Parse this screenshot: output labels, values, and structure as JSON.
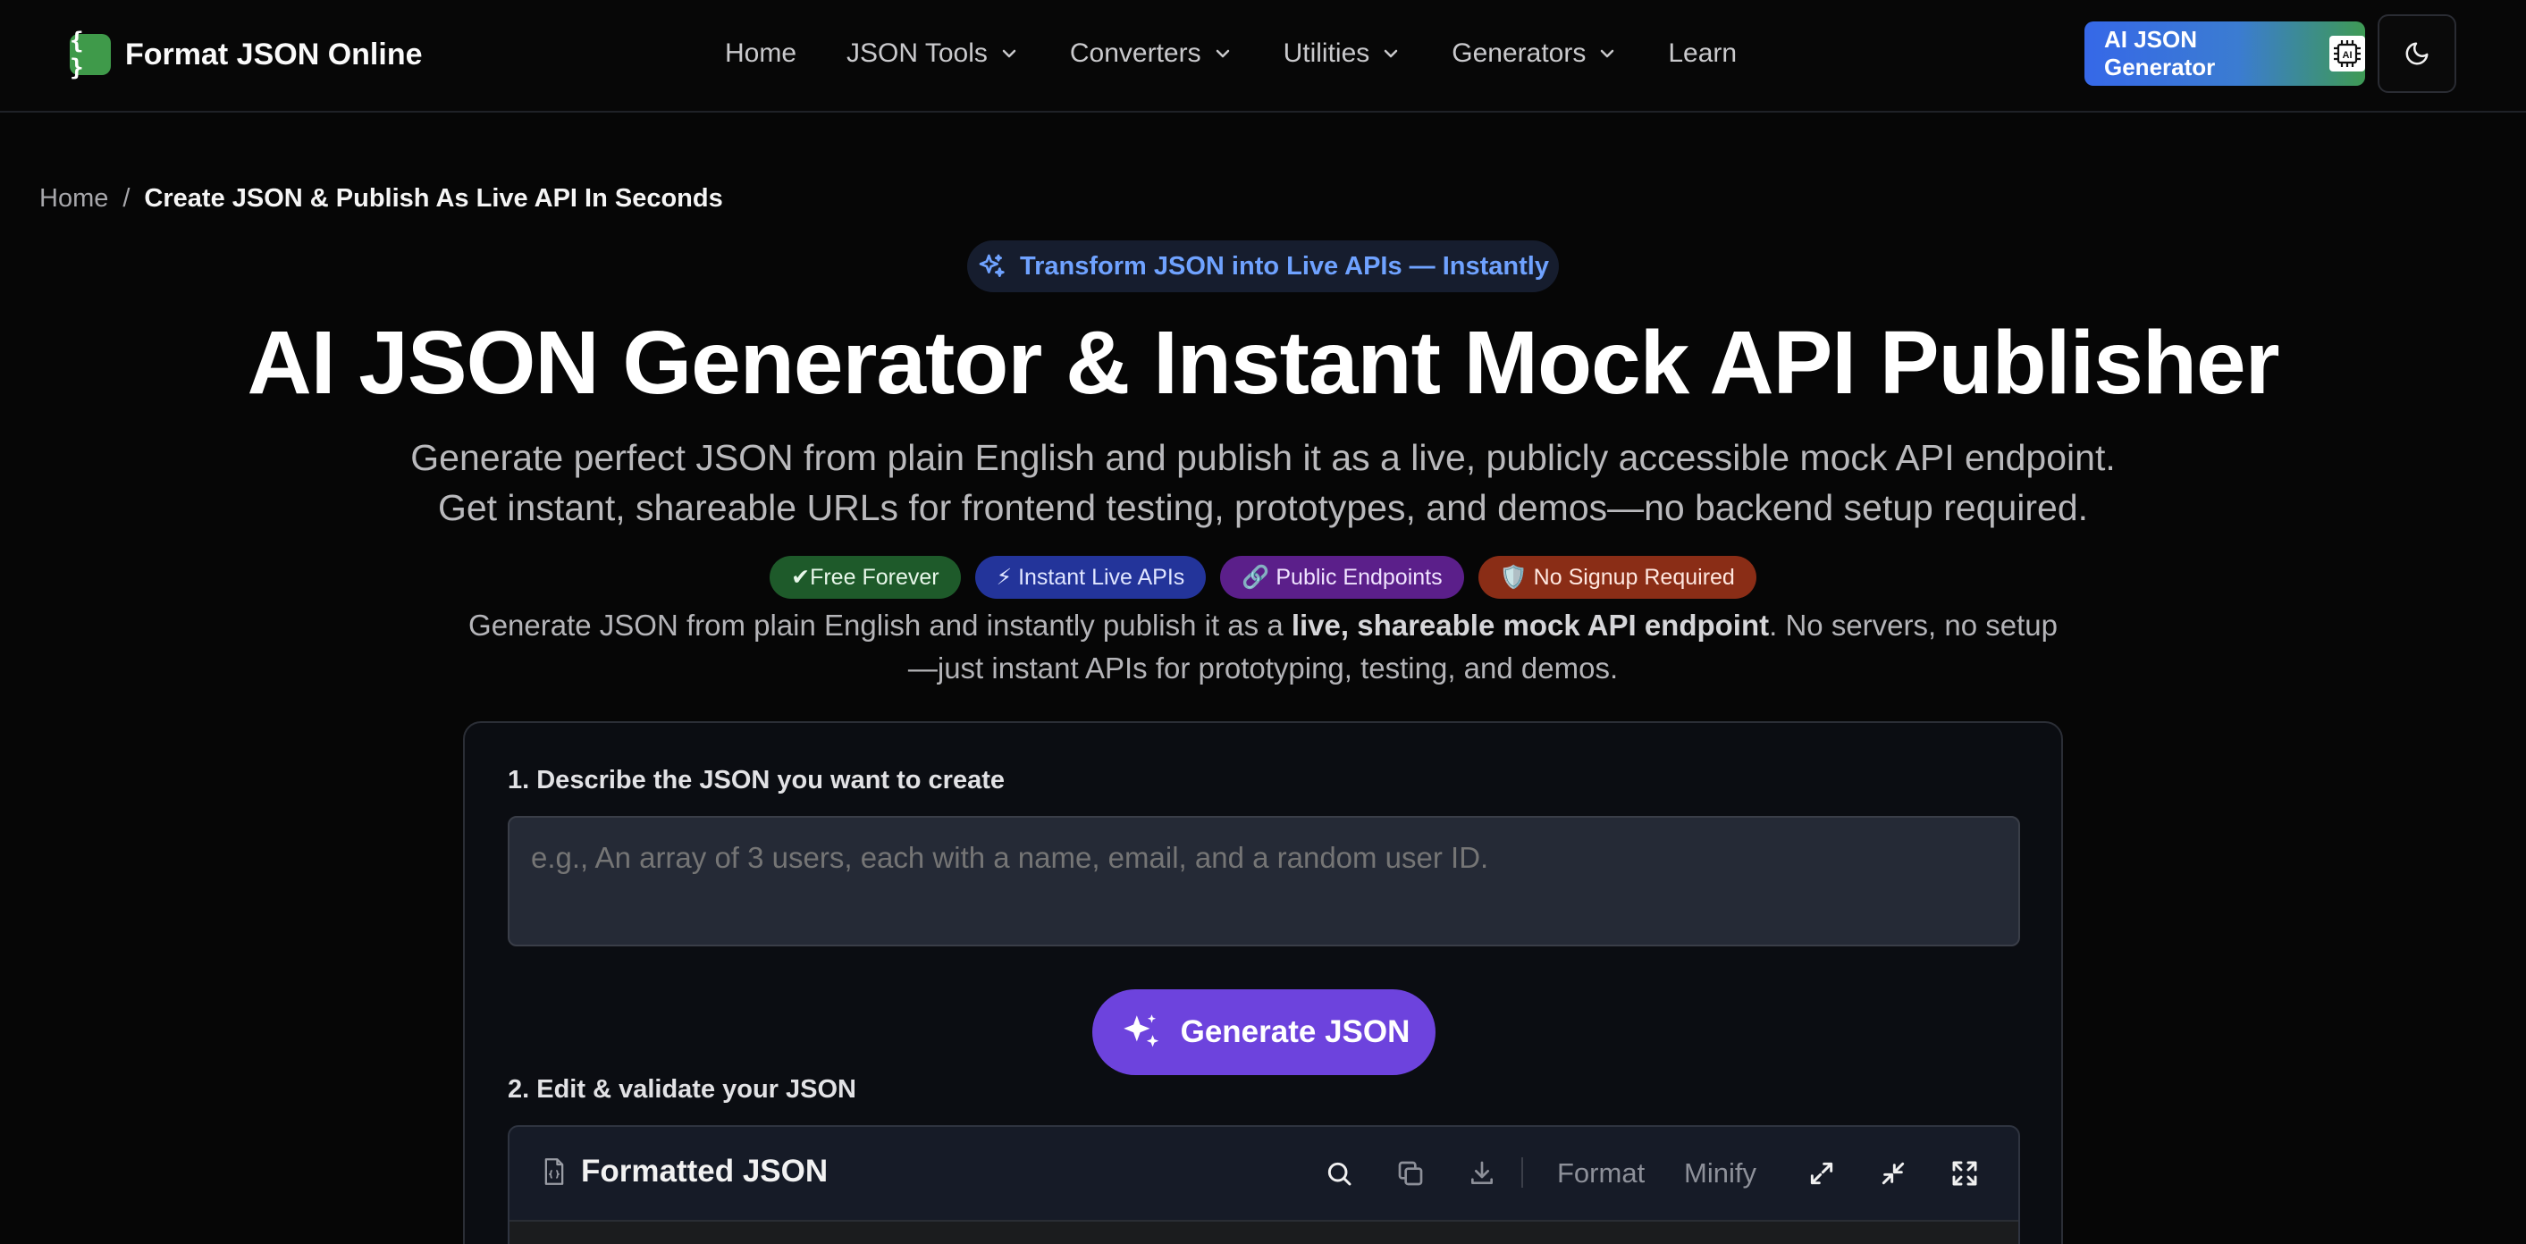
{
  "brand": {
    "logo_glyph": "{ }",
    "name": "Format JSON Online",
    "logo_color": "#3f9a4a"
  },
  "nav": {
    "items": [
      {
        "label": "Home",
        "dropdown": false
      },
      {
        "label": "JSON Tools",
        "dropdown": true
      },
      {
        "label": "Converters",
        "dropdown": true
      },
      {
        "label": "Utilities",
        "dropdown": true
      },
      {
        "label": "Generators",
        "dropdown": true
      },
      {
        "label": "Learn",
        "dropdown": false
      }
    ],
    "ai_button_label": "AI JSON Generator",
    "ai_button_icon": "ai-chip-icon",
    "theme_toggle_icon": "moon-icon"
  },
  "breadcrumb": {
    "home": "Home",
    "separator": "/",
    "current": "Create JSON & Publish As Live API In Seconds"
  },
  "hero": {
    "pill": "Transform JSON into Live APIs — Instantly",
    "title": "AI JSON Generator & Instant Mock API Publisher",
    "subtitle_line1": "Generate perfect JSON from plain English and publish it as a live, publicly accessible mock API endpoint.",
    "subtitle_line2": "Get instant, shareable URLs for frontend testing, prototypes, and demos—no backend setup required.",
    "badges": [
      {
        "label": "✔Free Forever",
        "color": "#1e5a2a"
      },
      {
        "label": "⚡ Instant Live APIs",
        "color": "#23349a"
      },
      {
        "label": "🔗 Public Endpoints",
        "color": "#5b1f8a"
      },
      {
        "label": "🛡️ No Signup Required",
        "color": "#8a2d16"
      }
    ],
    "desc_part1": "Generate JSON from plain English and instantly publish it as a ",
    "desc_bold": "live, shareable mock API endpoint",
    "desc_part2": ". No servers, no setup—just instant APIs for prototyping, testing, and demos."
  },
  "form": {
    "step1_label": "1. Describe the JSON you want to create",
    "prompt_placeholder": "e.g., An array of 3 users, each with a name, email, and a random user ID.",
    "prompt_value": "",
    "generate_label": "Generate JSON",
    "step2_label": "2. Edit & validate your JSON",
    "editor": {
      "title": "Formatted JSON",
      "format_label": "Format",
      "minify_label": "Minify"
    }
  },
  "colors": {
    "accent_purple": "#6d43dd",
    "pill_text": "#6fa2ff",
    "background": "#060606"
  }
}
